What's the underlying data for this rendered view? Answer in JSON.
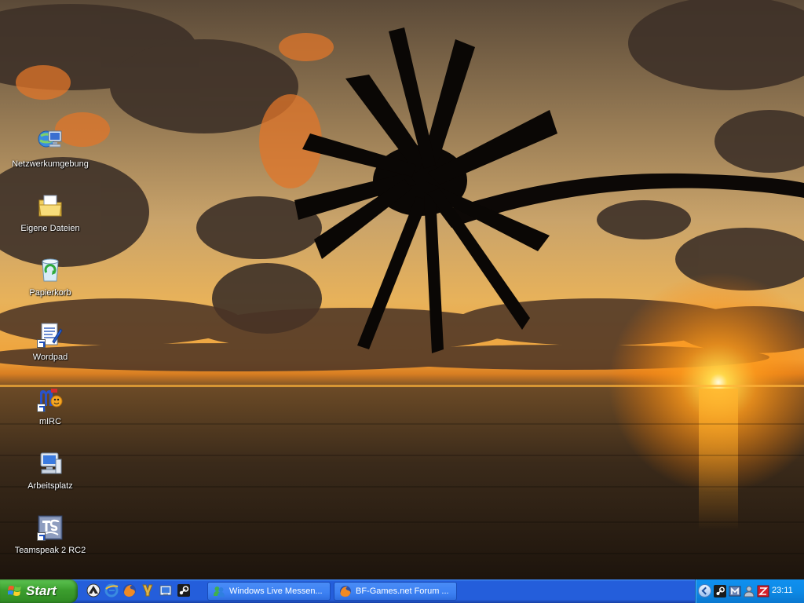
{
  "desktop": {
    "icons": [
      {
        "label": "Netzwerkumgebung",
        "icon": "network-places-icon",
        "shortcut": false
      },
      {
        "label": "Eigene Dateien",
        "icon": "my-documents-icon",
        "shortcut": false
      },
      {
        "label": "Papierkorb",
        "icon": "recycle-bin-icon",
        "shortcut": false
      },
      {
        "label": "Wordpad",
        "icon": "wordpad-icon",
        "shortcut": true
      },
      {
        "label": "mIRC",
        "icon": "mirc-icon",
        "shortcut": true
      },
      {
        "label": "Arbeitsplatz",
        "icon": "my-computer-icon",
        "shortcut": false
      },
      {
        "label": "Teamspeak 2 RC2",
        "icon": "teamspeak-icon",
        "shortcut": true
      }
    ]
  },
  "taskbar": {
    "start_label": "Start",
    "quick_launch": [
      "winamp-icon",
      "ie-icon",
      "firefox-icon",
      "tool-icon",
      "show-desktop-icon",
      "steam-icon"
    ],
    "tasks": [
      {
        "label": "Windows Live Messen...",
        "icon": "messenger-icon"
      },
      {
        "label": "BF-Games.net Forum ...",
        "icon": "firefox-icon"
      }
    ],
    "tray": {
      "icons": [
        "steam-tray-icon",
        "network-tray-icon",
        "user-tray-icon",
        "security-tray-icon"
      ],
      "clock": "23:11"
    }
  },
  "colors": {
    "taskbar_blue": "#245edb",
    "start_green": "#3c9e2e",
    "tray_blue": "#0d8ae6"
  }
}
